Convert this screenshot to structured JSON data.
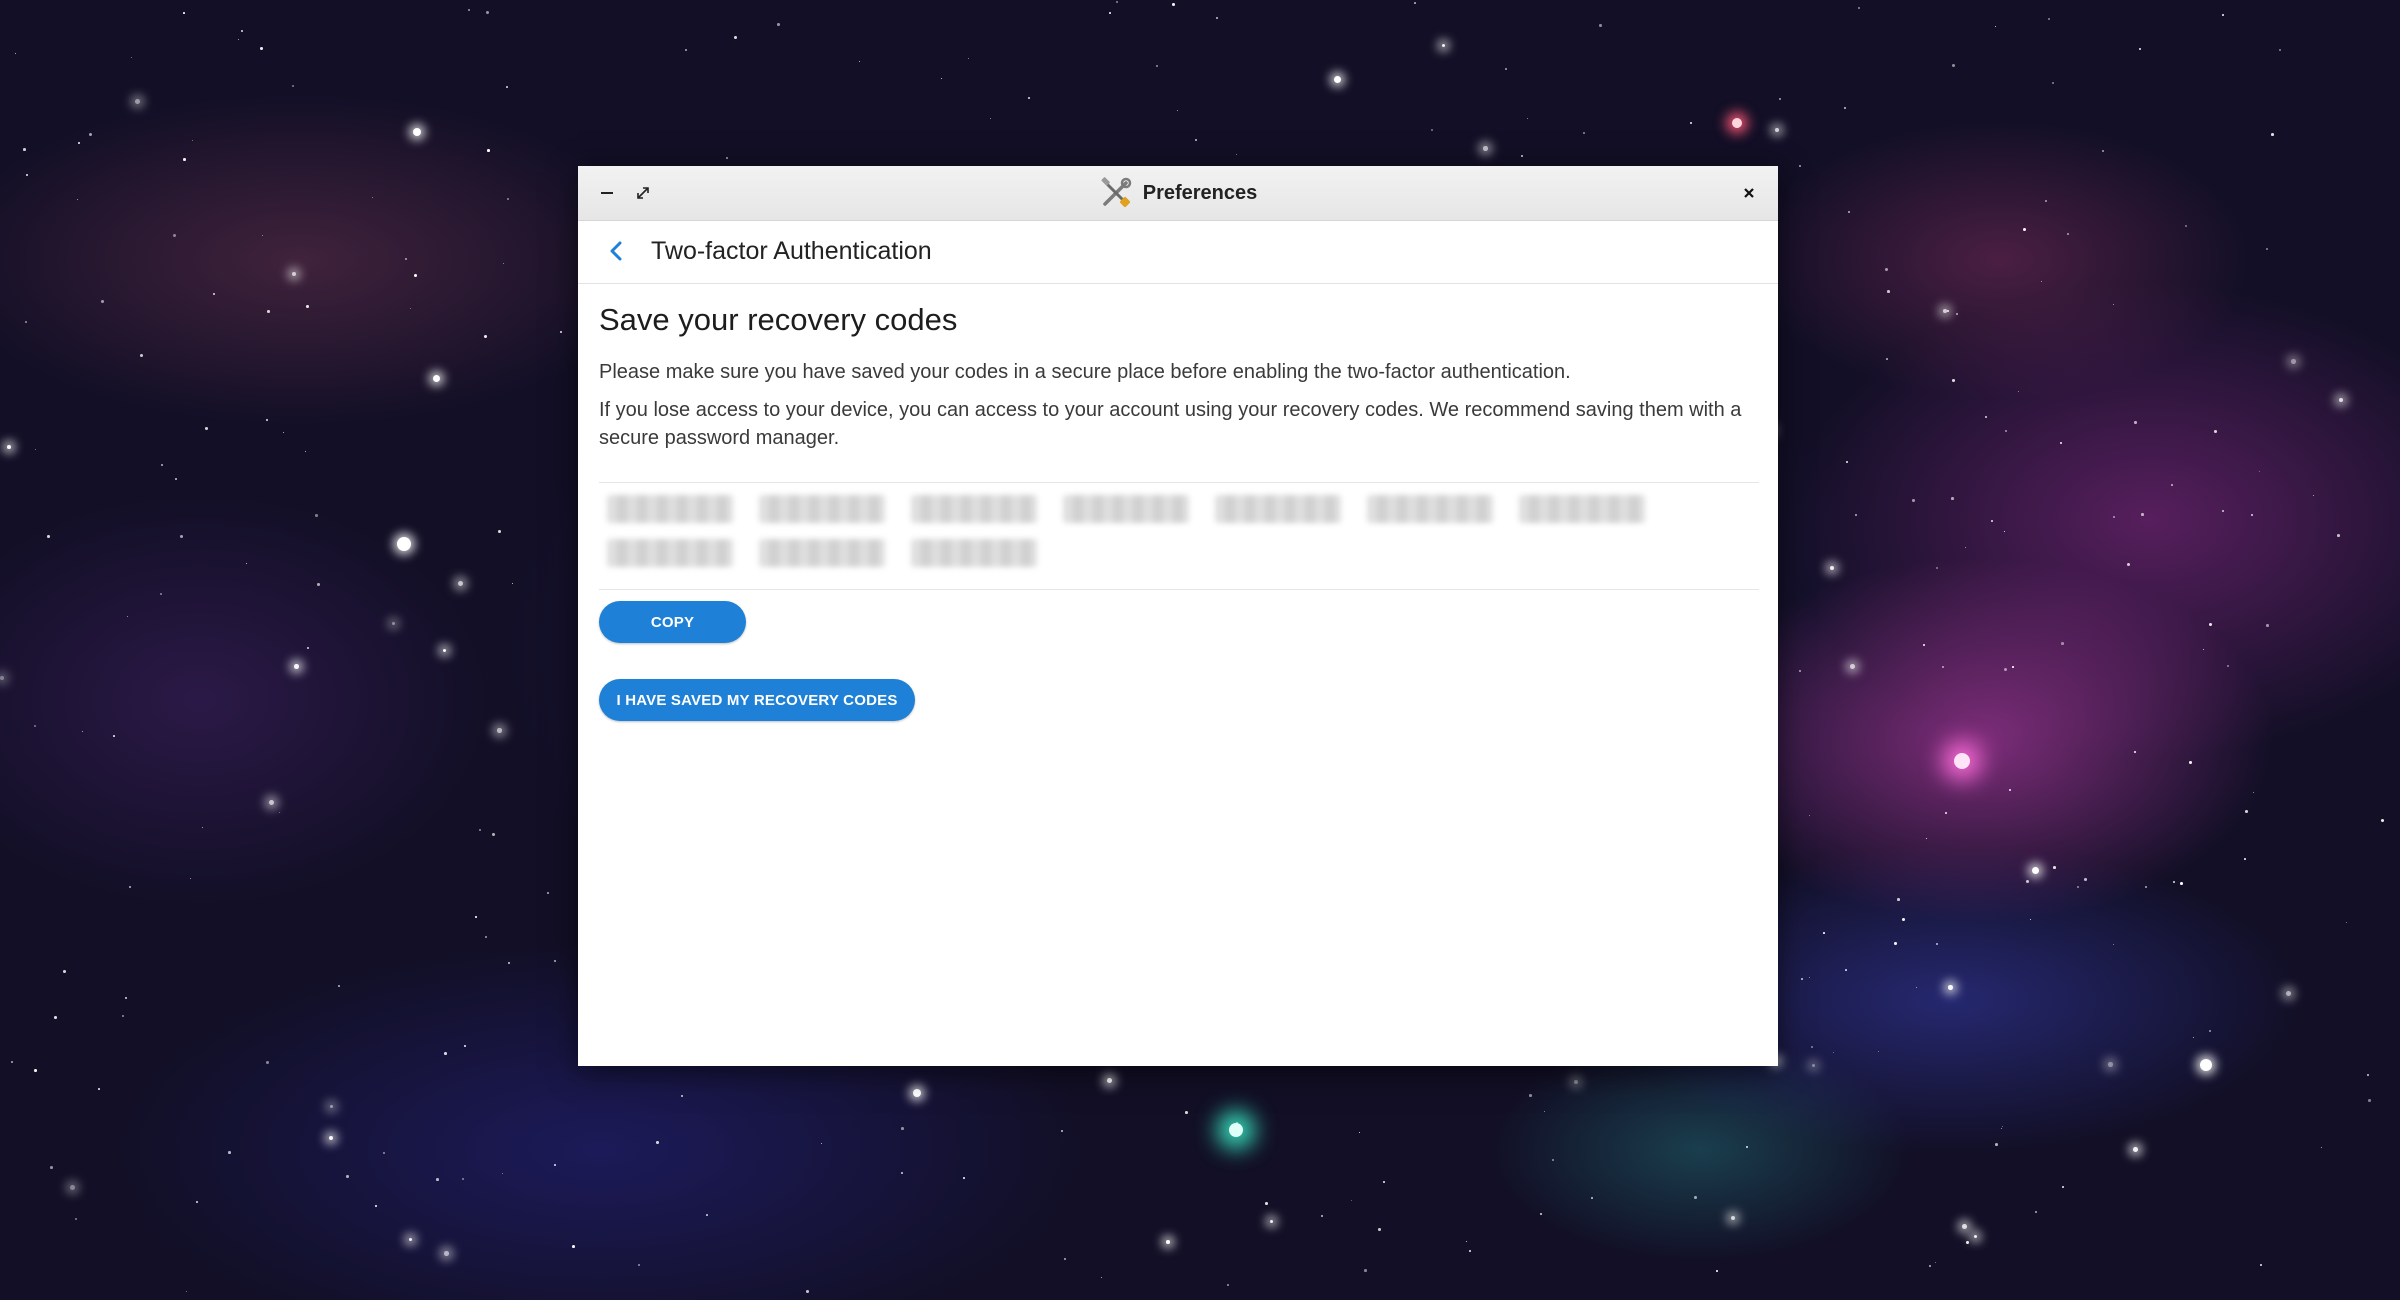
{
  "window": {
    "title": "Preferences",
    "app_icon": "tools-icon",
    "minimize_icon": "minimize-icon",
    "maximize_icon": "expand-icon",
    "close_icon": "close-icon"
  },
  "header": {
    "back_icon": "chevron-left-icon",
    "title": "Two-factor Authentication"
  },
  "content": {
    "heading": "Save your recovery codes",
    "paragraph_1": "Please make sure you have saved your codes in a secure place before enabling the two-factor authentication.",
    "paragraph_2": "If you lose access to your device, you can access to your account using your recovery codes. We recommend saving them with a secure password manager.",
    "recovery_codes_note": "codes are blurred/redacted in the screenshot",
    "recovery_codes": [
      "",
      "",
      "",
      "",
      "",
      "",
      "",
      "",
      "",
      ""
    ],
    "copy_button": "COPY",
    "confirm_button": "I HAVE SAVED MY RECOVERY CODES"
  },
  "colors": {
    "accent": "#1e80d6",
    "titlebar": "#ececec",
    "text": "#222222"
  }
}
